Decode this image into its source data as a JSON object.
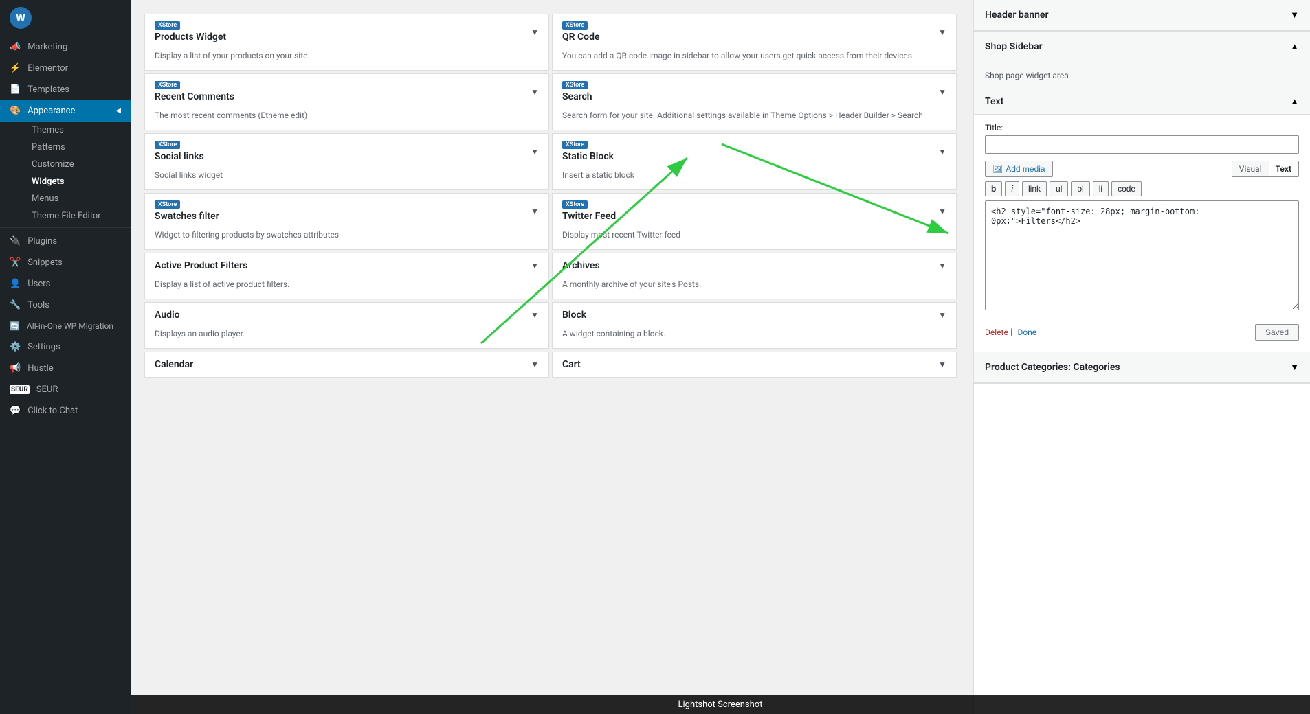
{
  "sidebar": {
    "items": [
      {
        "id": "marketing",
        "label": "Marketing",
        "icon": "📣"
      },
      {
        "id": "elementor",
        "label": "Elementor",
        "icon": "⚡"
      },
      {
        "id": "templates",
        "label": "Templates",
        "icon": "📄"
      },
      {
        "id": "appearance",
        "label": "Appearance",
        "icon": "🎨",
        "active": true
      },
      {
        "id": "plugins",
        "label": "Plugins",
        "icon": "🔌"
      },
      {
        "id": "snippets",
        "label": "Snippets",
        "icon": "✂️"
      },
      {
        "id": "users",
        "label": "Users",
        "icon": "👤"
      },
      {
        "id": "tools",
        "label": "Tools",
        "icon": "🔧"
      },
      {
        "id": "all-in-one",
        "label": "All-in-One WP Migration",
        "icon": "🔄"
      },
      {
        "id": "settings",
        "label": "Settings",
        "icon": "⚙️"
      },
      {
        "id": "hustle",
        "label": "Hustle",
        "icon": "📢"
      },
      {
        "id": "seur",
        "label": "SEUR",
        "icon": "📦"
      },
      {
        "id": "click-to-chat",
        "label": "Click to Chat",
        "icon": "💬"
      }
    ],
    "sub_items": [
      {
        "id": "themes",
        "label": "Themes"
      },
      {
        "id": "patterns",
        "label": "Patterns"
      },
      {
        "id": "customize",
        "label": "Customize"
      },
      {
        "id": "widgets",
        "label": "Widgets",
        "current": true
      },
      {
        "id": "menus",
        "label": "Menus"
      },
      {
        "id": "theme-file-editor",
        "label": "Theme File Editor"
      }
    ]
  },
  "widgets": [
    {
      "col": 0,
      "items": [
        {
          "badge": "XStore",
          "title": "Products Widget",
          "desc": "Display a list of your products on your site."
        },
        {
          "badge": "XStore",
          "title": "Recent Comments",
          "desc": "The most recent comments (Etheme edit)"
        },
        {
          "badge": "XStore",
          "title": "Social links",
          "desc": "Social links widget"
        },
        {
          "badge": "XStore",
          "title": "Swatches filter",
          "desc": "Widget to filtering products by swatches attributes"
        },
        {
          "badge": "",
          "title": "Active Product Filters",
          "desc": "Display a list of active product filters."
        },
        {
          "badge": "",
          "title": "Audio",
          "desc": "Displays an audio player."
        },
        {
          "badge": "",
          "title": "Calendar",
          "desc": ""
        }
      ]
    },
    {
      "col": 1,
      "items": [
        {
          "badge": "XStore",
          "title": "QR Code",
          "desc": "You can add a QR code image in sidebar to allow your users get quick access from their devices"
        },
        {
          "badge": "XStore",
          "title": "Search",
          "desc": "Search form for your site. Additional settings available in Theme Options > Header Builder > Search"
        },
        {
          "badge": "XStore",
          "title": "Static Block",
          "desc": "Insert a static block"
        },
        {
          "badge": "XStore",
          "title": "Twitter Feed",
          "desc": "Display most recent Twitter feed"
        },
        {
          "badge": "",
          "title": "Archives",
          "desc": "A monthly archive of your site's Posts."
        },
        {
          "badge": "",
          "title": "Block",
          "desc": "A widget containing a block."
        },
        {
          "badge": "",
          "title": "Cart",
          "desc": ""
        }
      ]
    }
  ],
  "right_panel": {
    "header_banner": {
      "title": "Header banner",
      "collapsed": true
    },
    "shop_sidebar": {
      "title": "Shop Sidebar",
      "desc": "Shop page widget area",
      "collapsed": false
    },
    "text_widget": {
      "header_title": "Text",
      "title_label": "Title:",
      "title_value": "",
      "title_placeholder": "",
      "add_media_label": "Add media",
      "tab_visual": "Visual",
      "tab_text": "Text",
      "active_tab": "Text",
      "format_buttons": [
        "b",
        "i",
        "link",
        "ul",
        "ol",
        "li",
        "code"
      ],
      "code_content": "<h2 style=\"font-size: 28px; margin-bottom: 0px;\">Filters</h2>",
      "delete_label": "Delete",
      "done_label": "Done",
      "saved_label": "Saved"
    },
    "product_categories": {
      "title": "Product Categories: Categories"
    }
  },
  "lightshot": {
    "label": "Lightshot Screenshot"
  }
}
